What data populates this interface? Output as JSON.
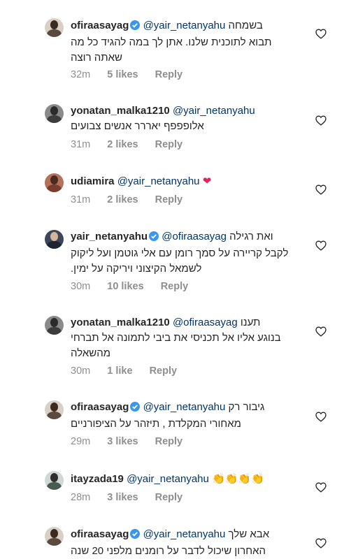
{
  "comments": [
    {
      "user": "ofiraasayag",
      "verified": true,
      "mention": "@yair_netanyahu",
      "line1": "בשמחה",
      "lines": [
        "תבוא לתוכנית שלנו. אתן לך במה להגיד כל מה",
        "שאתה רוצה"
      ],
      "time": "32m",
      "likes": "5 likes",
      "reply": "Reply"
    },
    {
      "user": "yonatan_malka1210",
      "verified": false,
      "mention": "@yair_netanyahu",
      "line1": "",
      "lines": [
        "אלופפפף יאררר אנשים צבועים"
      ],
      "time": "31m",
      "likes": "2 likes",
      "reply": "Reply"
    },
    {
      "user": "udiamira",
      "verified": false,
      "mention": "@yair_netanyahu",
      "line1": "❤",
      "lines": [],
      "time": "31m",
      "likes": "2 likes",
      "reply": "Reply"
    },
    {
      "user": "yair_netanyahu",
      "verified": true,
      "mention": "@ofiraasayag",
      "line1": "ואת רגילה",
      "lines": [
        "לקבל קריירה על סמך רומן עם אלי גוטמן ועל ליקוק",
        "לשמאל הקיצוני ויריקה על ימין."
      ],
      "time": "30m",
      "likes": "10 likes",
      "reply": "Reply"
    },
    {
      "user": "yonatan_malka1210",
      "verified": false,
      "mention": "@ofiraasayag",
      "line1": "תענו",
      "lines": [
        "בנוגע אליו אל תכניסי את ביבי לתמונה אל תברחי",
        "מהשאלה"
      ],
      "time": "30m",
      "likes": "1 like",
      "reply": "Reply"
    },
    {
      "user": "ofiraasayag",
      "verified": true,
      "mention": "@yair_netanyahu",
      "line1": "גיבור רק",
      "lines": [
        "מאחורי המקלדת , תיזהר על הציפורניים"
      ],
      "time": "29m",
      "likes": "3 likes",
      "reply": "Reply"
    },
    {
      "user": "itayzada19",
      "verified": false,
      "mention": "@yair_netanyahu",
      "line1": "👏👏👏👏",
      "lines": [],
      "time": "28m",
      "likes": "3 likes",
      "reply": "Reply"
    },
    {
      "user": "ofiraasayag",
      "verified": true,
      "mention": "@yair_netanyahu",
      "line1": "אבא שלך",
      "lines": [
        "האחרון שיכול לדבר על רומנים מלפני 20 שנה"
      ],
      "time": "",
      "likes": "",
      "reply": ""
    }
  ],
  "colors": {
    "text": "#262626",
    "mention": "#003569",
    "meta": "#8e8e8e",
    "verified": "#3897f0"
  },
  "icons": {
    "like": "heart-outline-icon",
    "verified": "verified-badge-icon"
  }
}
